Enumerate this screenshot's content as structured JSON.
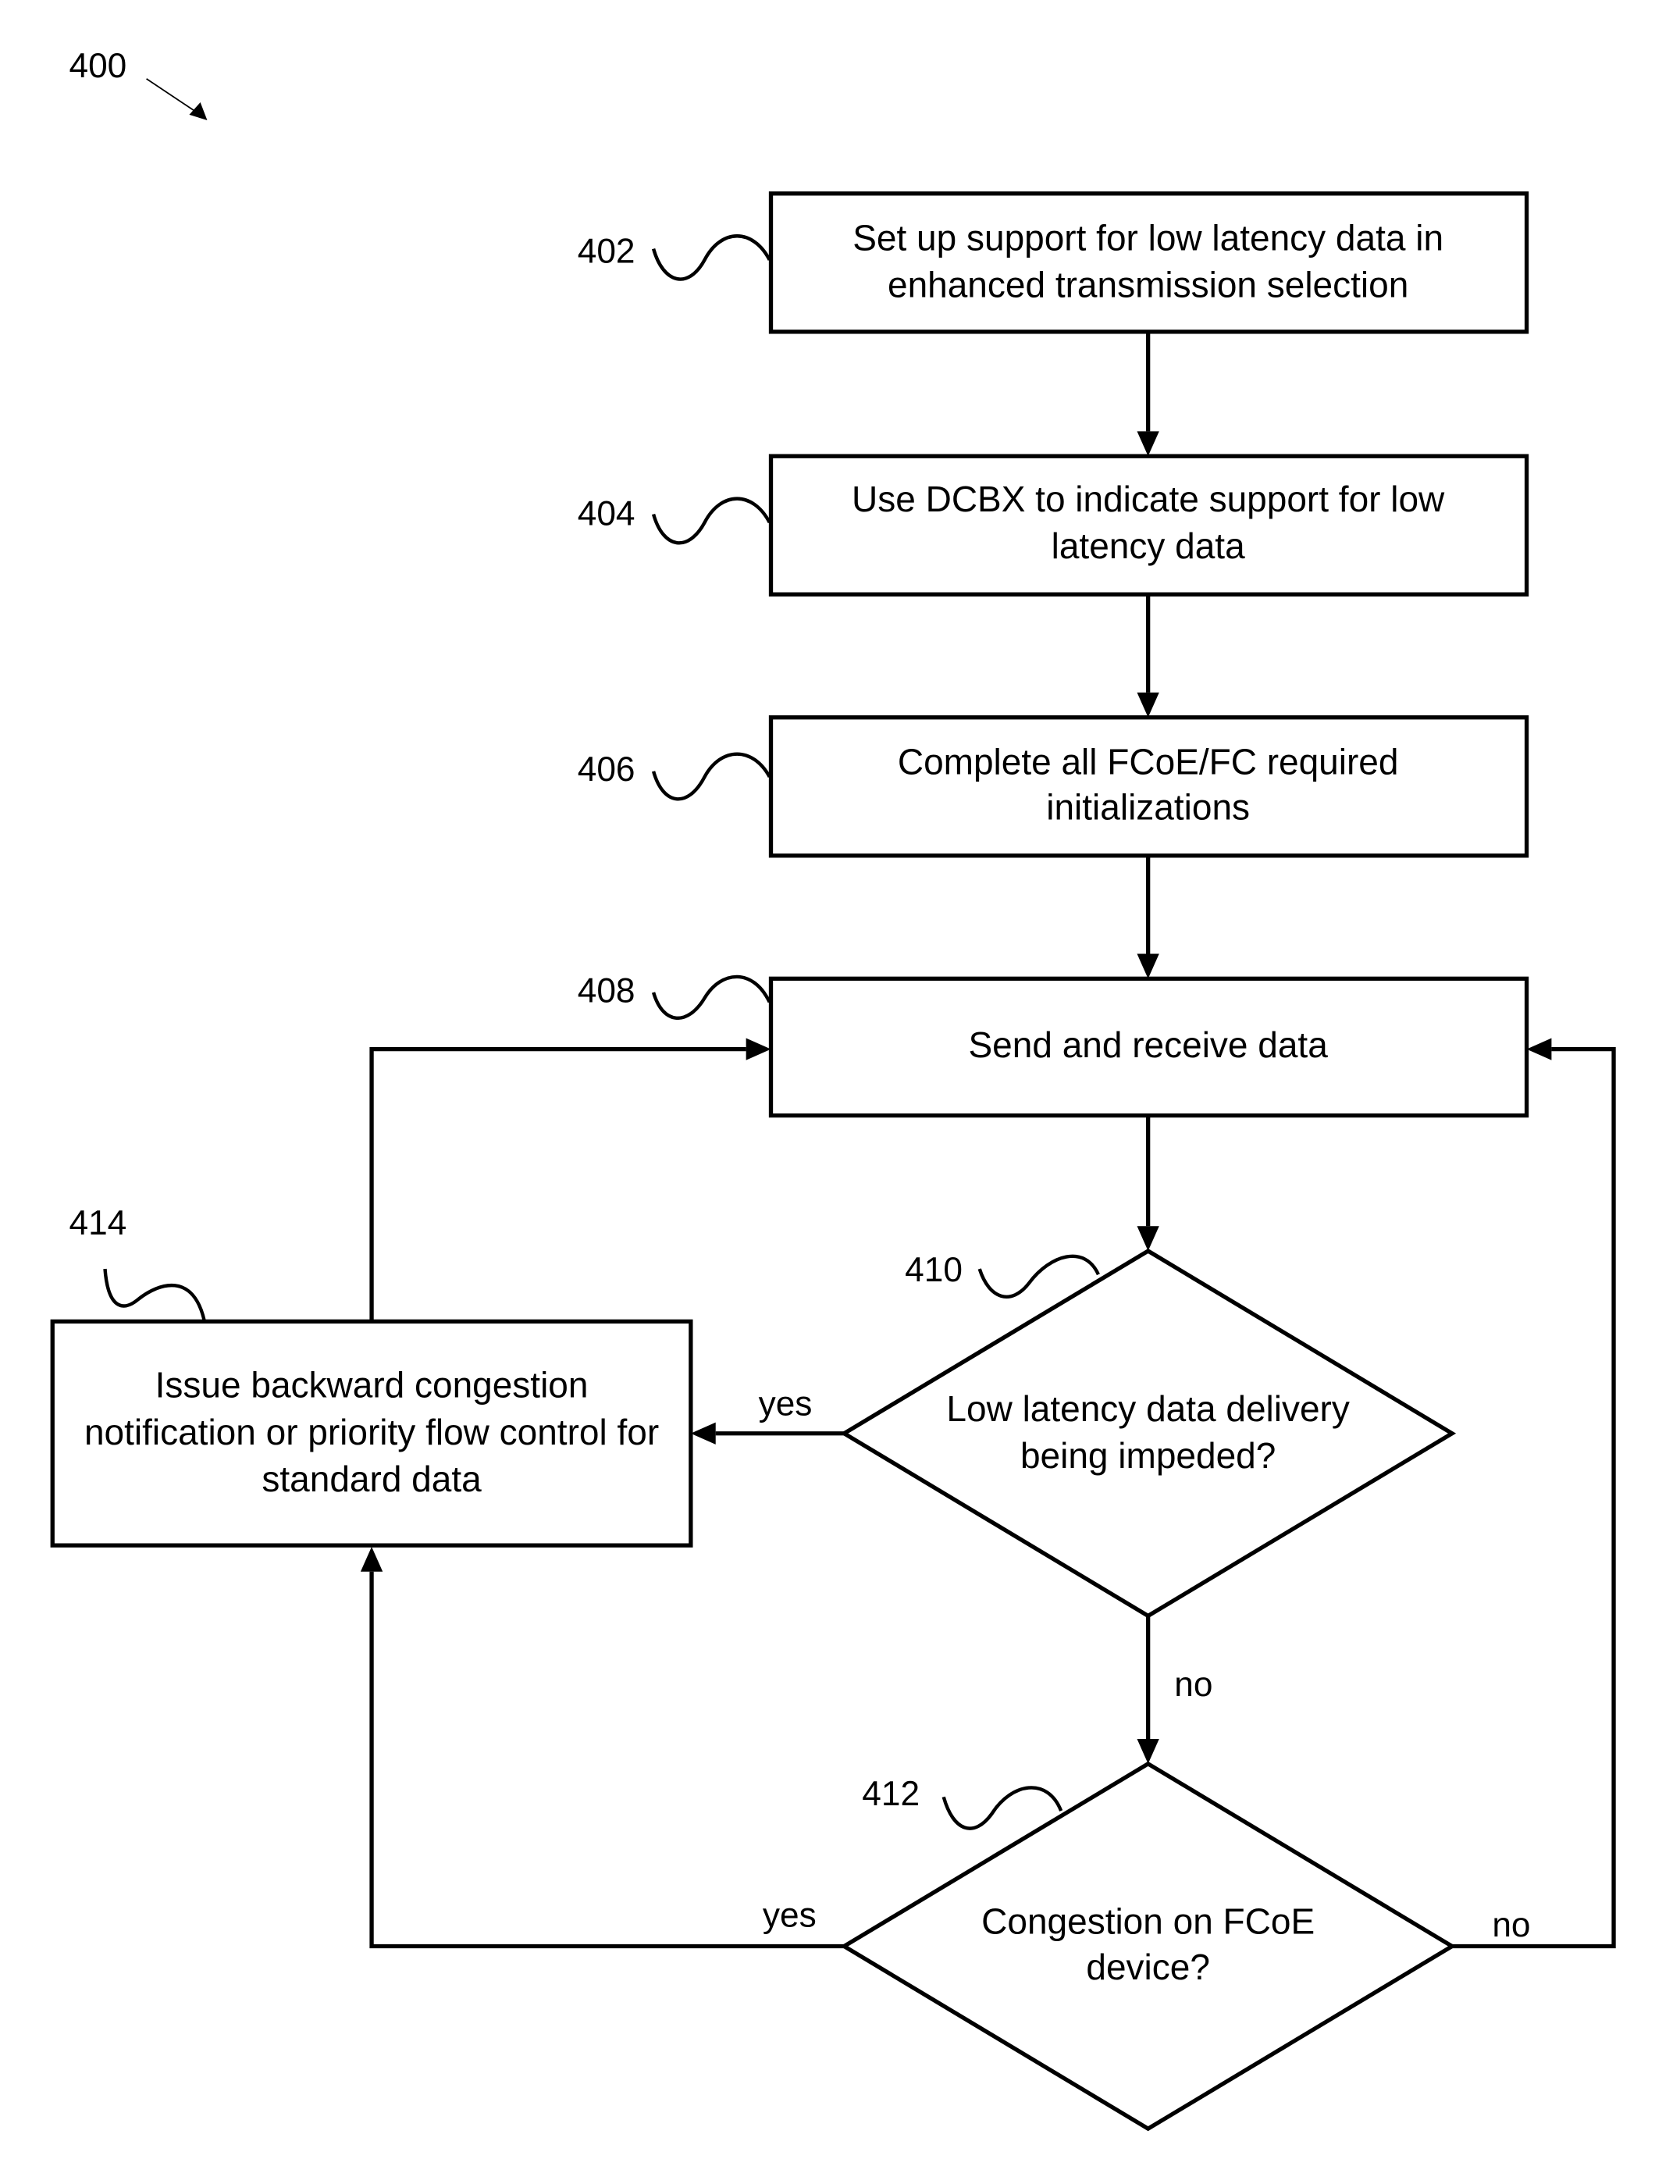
{
  "figure": {
    "ref": "400"
  },
  "steps": [
    {
      "ref": "402",
      "lines": [
        "Set up support for low latency data in",
        "enhanced transmission selection"
      ]
    },
    {
      "ref": "404",
      "lines": [
        "Use DCBX to indicate support for low",
        "latency data"
      ]
    },
    {
      "ref": "406",
      "lines": [
        "Complete all FCoE/FC required",
        "initializations"
      ]
    },
    {
      "ref": "408",
      "lines": [
        "Send and receive data"
      ]
    },
    {
      "ref": "414",
      "lines": [
        "Issue backward congestion",
        "notification or priority flow control for",
        "standard data"
      ]
    }
  ],
  "decisions": [
    {
      "ref": "410",
      "lines": [
        "Low latency data delivery",
        "being impeded?"
      ],
      "yes_label": "yes",
      "no_label": "no"
    },
    {
      "ref": "412",
      "lines": [
        "Congestion on FCoE",
        "device?"
      ],
      "yes_label": "yes",
      "no_label": "no"
    }
  ]
}
